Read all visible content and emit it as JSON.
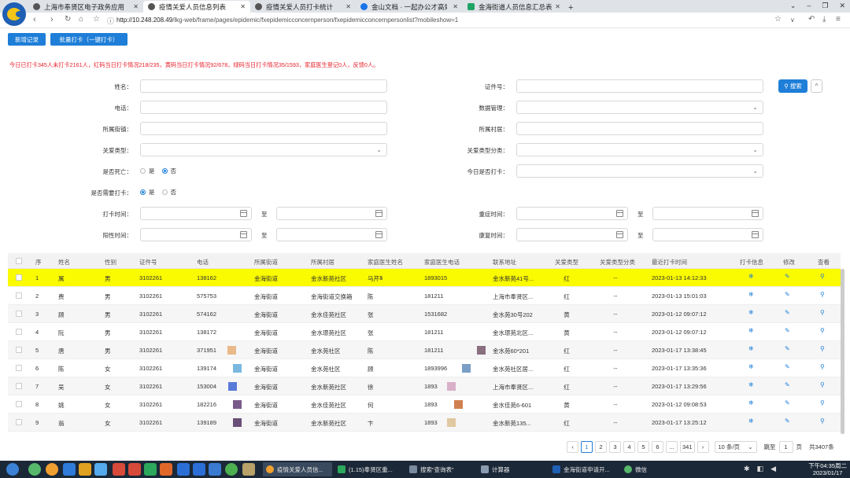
{
  "browser": {
    "tabs": [
      {
        "title": "上海市奉贤区电子政务应用"
      },
      {
        "title": "疫情关爱人员信息列表"
      },
      {
        "title": "疫情关爱人员打卡统计"
      },
      {
        "title": "金山文档 · 一起办公才高效"
      },
      {
        "title": "金海街道人员信息汇总表(I"
      }
    ],
    "new_tab": "+",
    "url_host": "http://10.248.208.49",
    "url_path": "/lkg-web/frame/pages/epidemic/fxepidemicconcernperson/fxepidemicconcernpersonlist?mobileshow=1"
  },
  "toolbar": {
    "add_label": "新增记录",
    "batch_label": "批量打卡（一键打卡）"
  },
  "summary": "今日已打卡345人未打卡2161人，红码当日打卡情况218/235，黄码当日打卡情况92/678，绿码当日打卡情况35/1593，家庭医生登记0人，反馈0人。",
  "form": {
    "name": "姓名：",
    "id_no": "证件号：",
    "phone": "电话：",
    "data_mgmt": "数据管理：",
    "street": "所属街镇：",
    "village": "所属村居：",
    "care_type": "关爱类型：",
    "care_subtype": "关爱类型分类：",
    "is_dead": "是否死亡：",
    "checked_today": "今日是否打卡：",
    "need_checkin": "是否需要打卡：",
    "checkin_time": "打卡时间：",
    "severe_time": "重症时间：",
    "positive_time": "阳性时间：",
    "recover_time": "康复时间：",
    "yes": "是",
    "no": "否",
    "to": "至",
    "search": "搜索",
    "collapse": "^"
  },
  "table": {
    "headers": [
      "序",
      "姓名",
      "性别",
      "证件号",
      "电话",
      "所属街道",
      "所属村居",
      "家庭医生姓名",
      "家庭医生电话",
      "联系地址",
      "关爱类型",
      "关爱类型分类",
      "最近打卡时间",
      "打卡信息",
      "修改",
      "查看"
    ],
    "rows": [
      [
        "1",
        "属",
        "男",
        "3102261",
        "138162",
        "金海街道",
        "金水新苑社区",
        "马芹琴",
        "1893015",
        "金水新苑41号...",
        "红",
        "--",
        "2023-01-13 14:12:33"
      ],
      [
        "2",
        "费",
        "男",
        "3102261",
        "575753",
        "金海街道",
        "金海街道交换箱",
        "陈",
        "181211",
        "上海市奉贤区...",
        "红",
        "--",
        "2023-01-13 15:01:03"
      ],
      [
        "3",
        "顾",
        "男",
        "3102261",
        "574162",
        "金海街道",
        "金水佳苑社区",
        "张",
        "1531682",
        "金水苑30号202",
        "黄",
        "--",
        "2023-01-12 09:07:12"
      ],
      [
        "4",
        "阮",
        "男",
        "3102261",
        "138172",
        "金海街道",
        "金水璟苑社区",
        "张",
        "181211",
        "金水璟苑北区...",
        "黄",
        "--",
        "2023-01-12 09:07:12"
      ],
      [
        "5",
        "唐",
        "男",
        "3102261",
        "371951",
        "金海街道",
        "金水苑社区",
        "陈",
        "181211",
        "金水苑60*201",
        "红",
        "--",
        "2023-01-17 13:38:45"
      ],
      [
        "6",
        "陈",
        "女",
        "3102261",
        "139174",
        "金海街道",
        "金水苑社区",
        "顾",
        "1893996",
        "金水苑社区居...",
        "红",
        "--",
        "2023-01-17 13:35:36"
      ],
      [
        "7",
        "吴",
        "女",
        "3102261",
        "153004",
        "金海街道",
        "金水新苑社区",
        "徐",
        "1893",
        "上海市奉贤区...",
        "红",
        "--",
        "2023-01-17 13:29:56"
      ],
      [
        "8",
        "姚",
        "女",
        "3102261",
        "182216",
        "金海街道",
        "金水佳苑社区",
        "何",
        "1893",
        "金水佳苑6-601",
        "黄",
        "--",
        "2023-01-12 09:08:53"
      ],
      [
        "9",
        "翁",
        "女",
        "3102261",
        "139189",
        "金海街道",
        "金水新苑社区",
        "卞",
        "1893",
        "金水新苑135...",
        "红",
        "--",
        "2023-01-17 13:25:12"
      ]
    ]
  },
  "pager": {
    "pages": [
      "1",
      "2",
      "3",
      "4",
      "5",
      "6",
      "...",
      "341"
    ],
    "prev": "‹",
    "next": "›",
    "page_size": "10 条/页",
    "jump_label": "跳至",
    "jump_value": "1",
    "page_unit": "页",
    "total": "共3407条"
  },
  "taskbar": {
    "windows": [
      "疫情关爱人员信...",
      "(1.15)奉贤区重...",
      "搜索“查询表”",
      "计算器",
      "金海街道申请开...",
      "微信"
    ],
    "time": "下午04:35周二",
    "date": "2023/01/17"
  },
  "colors": {
    "accent": "#1e7ed8",
    "highlight_row": "#fafa00",
    "summary_text": "#e8242e"
  }
}
